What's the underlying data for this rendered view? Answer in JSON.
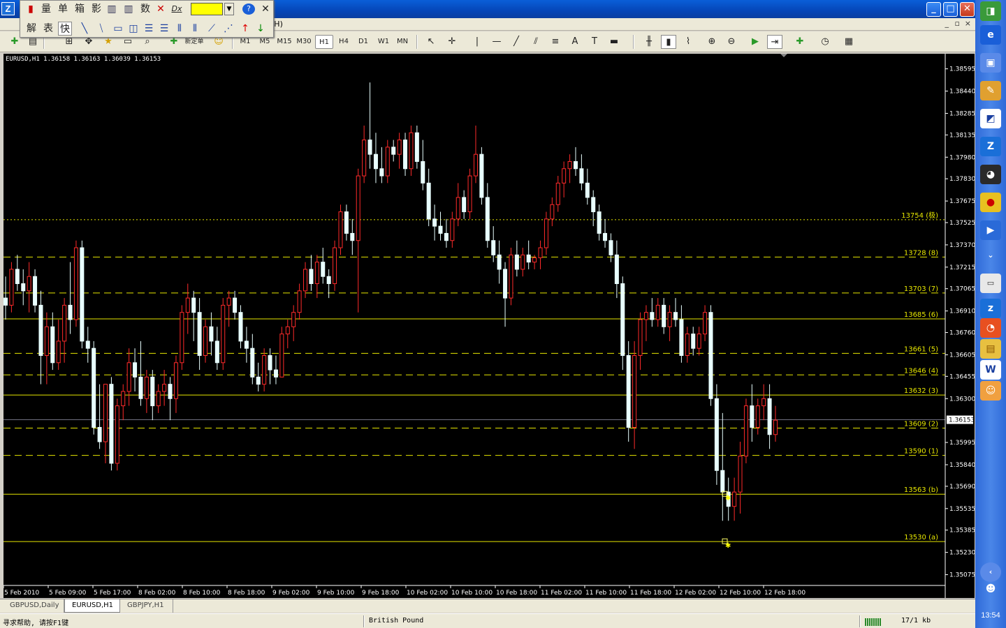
{
  "menubar": {
    "hlabel": "(H)",
    "mdi_min": "_",
    "mdi_restore": "▫",
    "mdi_close": "×"
  },
  "floatbar": {
    "row1": [
      "量",
      "单",
      "箱",
      "影",
      "数"
    ],
    "row2": [
      "解",
      "表",
      "快"
    ],
    "fx_label": "Dx"
  },
  "toolbar": {
    "timeframes": [
      "M1",
      "M5",
      "M15",
      "M30",
      "H1",
      "H4",
      "D1",
      "W1",
      "MN"
    ],
    "active_timeframe": "H1",
    "new_order": "新定单"
  },
  "chart": {
    "info": "EURUSD,H1  1.36158 1.36163 1.36039 1.36153",
    "symbol": "EURUSD",
    "timeframe": "H1",
    "ohlc": {
      "open": "1.36158",
      "high": "1.36163",
      "low": "1.36039",
      "close": "1.36153"
    },
    "current_price": "1.36153",
    "price_labels": [
      "1.38595",
      "1.38440",
      "1.38285",
      "1.38135",
      "1.37980",
      "1.37830",
      "1.37675",
      "1.37525",
      "1.37370",
      "1.37215",
      "1.37065",
      "1.36910",
      "1.36760",
      "1.36605",
      "1.36455",
      "1.36300",
      "1.35995",
      "1.35840",
      "1.35690",
      "1.35535",
      "1.35385",
      "1.35230",
      "1.35075"
    ],
    "price_min": 1.35,
    "price_max": 1.387,
    "time_labels": [
      "5 Feb 2010",
      "5 Feb 09:00",
      "5 Feb 17:00",
      "8 Feb 02:00",
      "8 Feb 10:00",
      "8 Feb 18:00",
      "9 Feb 02:00",
      "9 Feb 10:00",
      "9 Feb 18:00",
      "10 Feb 02:00",
      "10 Feb 10:00",
      "10 Feb 18:00",
      "11 Feb 02:00",
      "11 Feb 10:00",
      "11 Feb 18:00",
      "12 Feb 02:00",
      "12 Feb 10:00",
      "12 Feb 18:00"
    ],
    "levels": [
      {
        "label": "13754 (极)",
        "price": 1.37545,
        "style": "dot"
      },
      {
        "label": "13728 (8)",
        "price": 1.37285,
        "style": "dash"
      },
      {
        "label": "13703 (7)",
        "price": 1.37035,
        "style": "dash"
      },
      {
        "label": "13685 (6)",
        "price": 1.36855,
        "style": "solid"
      },
      {
        "label": "13661 (5)",
        "price": 1.36615,
        "style": "dash"
      },
      {
        "label": "13646 (4)",
        "price": 1.36465,
        "style": "dash"
      },
      {
        "label": "13632 (3)",
        "price": 1.36325,
        "style": "solid"
      },
      {
        "label": "13609 (2)",
        "price": 1.36095,
        "style": "dash"
      },
      {
        "label": "13590 (1)",
        "price": 1.35905,
        "style": "dash"
      },
      {
        "label": "13563 (b)",
        "price": 1.35635,
        "style": "solid"
      },
      {
        "label": "13530 (a)",
        "price": 1.35305,
        "style": "solid"
      }
    ],
    "colors": {
      "bull": "#ff2a2a",
      "bear": "#e8ffff",
      "level": "#e6e600",
      "bg": "#000000",
      "axis": "#ffffff"
    },
    "candles": [
      [
        1.37,
        1.3715,
        1.3685,
        1.3695
      ],
      [
        1.3695,
        1.3725,
        1.369,
        1.372
      ],
      [
        1.372,
        1.373,
        1.3705,
        1.371
      ],
      [
        1.371,
        1.372,
        1.3695,
        1.3705
      ],
      [
        1.3705,
        1.3725,
        1.369,
        1.3715
      ],
      [
        1.3715,
        1.372,
        1.369,
        1.3695
      ],
      [
        1.3695,
        1.3705,
        1.364,
        1.366
      ],
      [
        1.366,
        1.369,
        1.364,
        1.368
      ],
      [
        1.368,
        1.369,
        1.365,
        1.3655
      ],
      [
        1.3655,
        1.3685,
        1.365,
        1.367
      ],
      [
        1.367,
        1.37,
        1.3655,
        1.3695
      ],
      [
        1.3695,
        1.3725,
        1.3675,
        1.3685
      ],
      [
        1.3685,
        1.374,
        1.368,
        1.3735
      ],
      [
        1.3735,
        1.374,
        1.3665,
        1.367
      ],
      [
        1.367,
        1.368,
        1.3655,
        1.3665
      ],
      [
        1.3665,
        1.367,
        1.3605,
        1.361
      ],
      [
        1.361,
        1.364,
        1.3595,
        1.36
      ],
      [
        1.36,
        1.364,
        1.3585,
        1.364
      ],
      [
        1.364,
        1.3645,
        1.358,
        1.3585
      ],
      [
        1.3585,
        1.363,
        1.358,
        1.3625
      ],
      [
        1.3625,
        1.364,
        1.3615,
        1.3635
      ],
      [
        1.3635,
        1.3665,
        1.3625,
        1.3655
      ],
      [
        1.3655,
        1.3665,
        1.3635,
        1.3645
      ],
      [
        1.3645,
        1.367,
        1.3625,
        1.363
      ],
      [
        1.363,
        1.365,
        1.362,
        1.3645
      ],
      [
        1.3645,
        1.365,
        1.3615,
        1.3625
      ],
      [
        1.3625,
        1.364,
        1.362,
        1.3635
      ],
      [
        1.3635,
        1.365,
        1.3625,
        1.364
      ],
      [
        1.364,
        1.3645,
        1.3615,
        1.363
      ],
      [
        1.363,
        1.366,
        1.362,
        1.3655
      ],
      [
        1.3655,
        1.3695,
        1.365,
        1.369
      ],
      [
        1.369,
        1.371,
        1.3675,
        1.37
      ],
      [
        1.37,
        1.3705,
        1.367,
        1.369
      ],
      [
        1.369,
        1.37,
        1.365,
        1.366
      ],
      [
        1.366,
        1.3685,
        1.3655,
        1.368
      ],
      [
        1.368,
        1.369,
        1.366,
        1.367
      ],
      [
        1.367,
        1.368,
        1.365,
        1.3655
      ],
      [
        1.3655,
        1.37,
        1.365,
        1.3695
      ],
      [
        1.3695,
        1.3705,
        1.368,
        1.37
      ],
      [
        1.37,
        1.3705,
        1.3685,
        1.369
      ],
      [
        1.369,
        1.3695,
        1.3665,
        1.367
      ],
      [
        1.367,
        1.368,
        1.3655,
        1.3665
      ],
      [
        1.3665,
        1.3675,
        1.364,
        1.3645
      ],
      [
        1.3645,
        1.3655,
        1.3635,
        1.364
      ],
      [
        1.364,
        1.3665,
        1.3635,
        1.366
      ],
      [
        1.366,
        1.3665,
        1.364,
        1.365
      ],
      [
        1.365,
        1.366,
        1.364,
        1.3645
      ],
      [
        1.3645,
        1.368,
        1.3645,
        1.3675
      ],
      [
        1.3675,
        1.3685,
        1.3665,
        1.368
      ],
      [
        1.368,
        1.3695,
        1.367,
        1.369
      ],
      [
        1.369,
        1.371,
        1.3685,
        1.3705
      ],
      [
        1.3705,
        1.3725,
        1.37,
        1.372
      ],
      [
        1.372,
        1.373,
        1.3705,
        1.371
      ],
      [
        1.371,
        1.373,
        1.37,
        1.3725
      ],
      [
        1.3725,
        1.3735,
        1.371,
        1.3715
      ],
      [
        1.3715,
        1.372,
        1.37,
        1.371
      ],
      [
        1.371,
        1.374,
        1.3705,
        1.3735
      ],
      [
        1.3735,
        1.3765,
        1.373,
        1.376
      ],
      [
        1.376,
        1.3765,
        1.374,
        1.3745
      ],
      [
        1.3745,
        1.3755,
        1.373,
        1.374
      ],
      [
        1.374,
        1.379,
        1.369,
        1.3785
      ],
      [
        1.3785,
        1.382,
        1.378,
        1.381
      ],
      [
        1.381,
        1.385,
        1.379,
        1.38
      ],
      [
        1.38,
        1.3815,
        1.378,
        1.379
      ],
      [
        1.379,
        1.3805,
        1.378,
        1.3785
      ],
      [
        1.3785,
        1.381,
        1.378,
        1.3805
      ],
      [
        1.3805,
        1.381,
        1.3795,
        1.38
      ],
      [
        1.38,
        1.3815,
        1.379,
        1.381
      ],
      [
        1.381,
        1.3815,
        1.3785,
        1.379
      ],
      [
        1.379,
        1.382,
        1.3785,
        1.3815
      ],
      [
        1.3815,
        1.382,
        1.379,
        1.3795
      ],
      [
        1.3795,
        1.381,
        1.3775,
        1.378
      ],
      [
        1.378,
        1.379,
        1.375,
        1.3755
      ],
      [
        1.3755,
        1.3765,
        1.374,
        1.375
      ],
      [
        1.375,
        1.376,
        1.374,
        1.3745
      ],
      [
        1.3745,
        1.3755,
        1.3735,
        1.374
      ],
      [
        1.374,
        1.376,
        1.3735,
        1.3755
      ],
      [
        1.3755,
        1.378,
        1.375,
        1.377
      ],
      [
        1.377,
        1.3775,
        1.3755,
        1.376
      ],
      [
        1.376,
        1.379,
        1.3755,
        1.3785
      ],
      [
        1.3785,
        1.382,
        1.378,
        1.38
      ],
      [
        1.38,
        1.3805,
        1.3765,
        1.377
      ],
      [
        1.377,
        1.378,
        1.3735,
        1.374
      ],
      [
        1.374,
        1.375,
        1.3725,
        1.373
      ],
      [
        1.373,
        1.374,
        1.371,
        1.372
      ],
      [
        1.372,
        1.3725,
        1.368,
        1.37
      ],
      [
        1.37,
        1.3735,
        1.3695,
        1.373
      ],
      [
        1.373,
        1.374,
        1.3715,
        1.372
      ],
      [
        1.372,
        1.3735,
        1.3715,
        1.373
      ],
      [
        1.373,
        1.374,
        1.372,
        1.3725
      ],
      [
        1.3725,
        1.373,
        1.372,
        1.3728
      ],
      [
        1.3728,
        1.374,
        1.372,
        1.3735
      ],
      [
        1.3735,
        1.376,
        1.373,
        1.3755
      ],
      [
        1.3755,
        1.377,
        1.375,
        1.3765
      ],
      [
        1.3765,
        1.3785,
        1.376,
        1.378
      ],
      [
        1.378,
        1.3795,
        1.377,
        1.379
      ],
      [
        1.379,
        1.38,
        1.378,
        1.3795
      ],
      [
        1.3795,
        1.3805,
        1.3785,
        1.379
      ],
      [
        1.379,
        1.38,
        1.3775,
        1.378
      ],
      [
        1.378,
        1.379,
        1.3765,
        1.377
      ],
      [
        1.377,
        1.3775,
        1.375,
        1.376
      ],
      [
        1.376,
        1.3765,
        1.374,
        1.3745
      ],
      [
        1.3745,
        1.3755,
        1.3735,
        1.374
      ],
      [
        1.374,
        1.3745,
        1.3725,
        1.373
      ],
      [
        1.373,
        1.374,
        1.37,
        1.371
      ],
      [
        1.371,
        1.3715,
        1.365,
        1.366
      ],
      [
        1.366,
        1.367,
        1.36,
        1.361
      ],
      [
        1.361,
        1.367,
        1.3595,
        1.366
      ],
      [
        1.366,
        1.369,
        1.365,
        1.3685
      ],
      [
        1.3685,
        1.3695,
        1.367,
        1.369
      ],
      [
        1.369,
        1.37,
        1.368,
        1.3685
      ],
      [
        1.3685,
        1.37,
        1.368,
        1.3695
      ],
      [
        1.3695,
        1.37,
        1.3675,
        1.368
      ],
      [
        1.368,
        1.3695,
        1.367,
        1.369
      ],
      [
        1.369,
        1.37,
        1.368,
        1.3685
      ],
      [
        1.3685,
        1.3695,
        1.3655,
        1.366
      ],
      [
        1.366,
        1.368,
        1.3655,
        1.3675
      ],
      [
        1.3675,
        1.368,
        1.366,
        1.3665
      ],
      [
        1.3665,
        1.368,
        1.366,
        1.3675
      ],
      [
        1.3675,
        1.3695,
        1.367,
        1.369
      ],
      [
        1.369,
        1.3695,
        1.3625,
        1.363
      ],
      [
        1.363,
        1.364,
        1.357,
        1.358
      ],
      [
        1.358,
        1.362,
        1.3545,
        1.3565
      ],
      [
        1.3565,
        1.3575,
        1.3545,
        1.3555
      ],
      [
        1.3555,
        1.3575,
        1.3545,
        1.3565
      ],
      [
        1.3565,
        1.36,
        1.355,
        1.359
      ],
      [
        1.359,
        1.363,
        1.3585,
        1.3625
      ],
      [
        1.3625,
        1.364,
        1.36,
        1.361
      ],
      [
        1.361,
        1.363,
        1.3605,
        1.3625
      ],
      [
        1.3625,
        1.364,
        1.3615,
        1.363
      ],
      [
        1.363,
        1.364,
        1.3595,
        1.3605
      ],
      [
        1.3605,
        1.3625,
        1.36,
        1.3615
      ]
    ]
  },
  "tabs": [
    {
      "label": "GBPUSD,Daily",
      "active": false
    },
    {
      "label": "EURUSD,H1",
      "active": true
    },
    {
      "label": "GBPJPY,H1",
      "active": false
    }
  ],
  "status": {
    "help": "寻求帮助, 请按F1键",
    "profile": "British Pound",
    "traffic": "17/1 kb"
  },
  "quickbar": {
    "clock": "13:54"
  }
}
